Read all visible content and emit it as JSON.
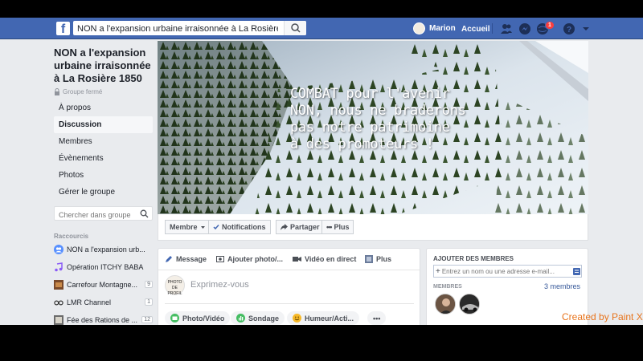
{
  "topbar": {
    "search_value": "NON a l'expansion urbaine irraisonnée à La Rosière 1850",
    "user_name": "Marion",
    "home_label": "Accueil",
    "notif_badge": "1",
    "brand_color": "#4267b2"
  },
  "group": {
    "title": "NON a l'expansion urbaine irraisonnée à La Rosière 1850",
    "privacy": "Groupe fermé",
    "nav": [
      "À propos",
      "Discussion",
      "Membres",
      "Évènements",
      "Photos",
      "Gérer le groupe"
    ],
    "active_nav": "Discussion",
    "search_placeholder": "Chercher dans groupe"
  },
  "shortcuts": {
    "title": "Raccourcis",
    "items": [
      {
        "label": "NON a l'expansion urb...",
        "count": "",
        "icon": "group-icon"
      },
      {
        "label": "Opération ITCHY BABA",
        "count": "",
        "icon": "music-icon"
      },
      {
        "label": "Carrefour Montagne...",
        "count": "9",
        "icon": "page-icon"
      },
      {
        "label": "LMR Channel",
        "count": "1",
        "icon": "glasses-icon"
      },
      {
        "label": "Fée des Rations de ...",
        "count": "12",
        "icon": "page-icon"
      }
    ]
  },
  "cover": {
    "line1": "COMBAT pour l'avenir",
    "line2": "NON, nous ne braderons",
    "line3": "pas notre patrimoine",
    "line4": "à des promoteurs !"
  },
  "actions": {
    "member": "Membre",
    "notifications": "Notifications",
    "share": "Partager",
    "more": "Plus"
  },
  "composer": {
    "tab_message": "Message",
    "tab_photo": "Ajouter photo/...",
    "tab_live": "Vidéo en direct",
    "tab_more": "Plus",
    "avatar_text": "PHOTO DE PROFIL",
    "placeholder": "Exprimez-vous",
    "pill_photo": "Photo/Vidéo",
    "pill_poll": "Sondage",
    "pill_mood": "Humeur/Acti...",
    "pill_more": "•••"
  },
  "members_box": {
    "title": "AJOUTER DES MEMBRES",
    "input_placeholder": "Entrez un nom ou une adresse e-mail...",
    "subtitle": "MEMBRES",
    "count": "3 membres"
  },
  "watermark": "Created by Paint X"
}
